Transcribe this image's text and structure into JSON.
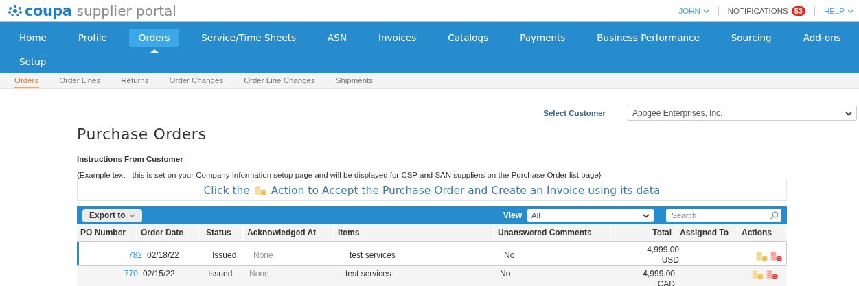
{
  "header": {
    "logo_mark": "coupa",
    "logo_text": "supplier portal",
    "user_menu": "JOHN",
    "notifications": {
      "label": "NOTIFICATIONS",
      "count": "53"
    },
    "help_menu": "HELP"
  },
  "nav": {
    "items": [
      {
        "label": "Home",
        "selected": false
      },
      {
        "label": "Profile",
        "selected": false
      },
      {
        "label": "Orders",
        "selected": true
      },
      {
        "label": "Service/Time Sheets",
        "selected": false
      },
      {
        "label": "ASN",
        "selected": false
      },
      {
        "label": "Invoices",
        "selected": false
      },
      {
        "label": "Catalogs",
        "selected": false
      },
      {
        "label": "Payments",
        "selected": false
      },
      {
        "label": "Business Performance",
        "selected": false
      },
      {
        "label": "Sourcing",
        "selected": false
      },
      {
        "label": "Add-ons",
        "selected": false
      },
      {
        "label": "Setup",
        "selected": false
      }
    ]
  },
  "subnav": {
    "items": [
      {
        "label": "Orders",
        "selected": true
      },
      {
        "label": "Order Lines",
        "selected": false
      },
      {
        "label": "Returns",
        "selected": false
      },
      {
        "label": "Order Changes",
        "selected": false
      },
      {
        "label": "Order Line Changes",
        "selected": false
      },
      {
        "label": "Shipments",
        "selected": false
      }
    ]
  },
  "customer_select": {
    "label": "Select Customer",
    "value": "Apogee Enterprises, Inc."
  },
  "page_title": "Purchase Orders",
  "instructions": {
    "heading": "Instructions From Customer",
    "text": "{Example text - this is set on your Company Information setup page and will be displayed for CSP and SAN suppliers on the Purchase Order list page}"
  },
  "banner": {
    "before": "Click the",
    "after": "Action to Accept the Purchase Order and Create an Invoice using its data"
  },
  "table": {
    "export_button": "Export to",
    "view_label": "View",
    "view_value": "All",
    "search_placeholder": "Search",
    "columns": [
      "PO Number",
      "Order Date",
      "Status",
      "Acknowledged At",
      "Items",
      "Unanswered Comments",
      "Total",
      "Assigned To",
      "Actions"
    ],
    "rows": [
      {
        "po_number": "782",
        "order_date": "02/18/22",
        "status": "Issued",
        "acknowledged_at": "None",
        "items": "test services",
        "unanswered_comments": "No",
        "total": "4,999.00 USD",
        "selected": true
      },
      {
        "po_number": "770",
        "order_date": "02/15/22",
        "status": "Issued",
        "acknowledged_at": "None",
        "items": "test services",
        "unanswered_comments": "No",
        "total": "4,999.00 CAD",
        "selected": false
      }
    ]
  }
}
